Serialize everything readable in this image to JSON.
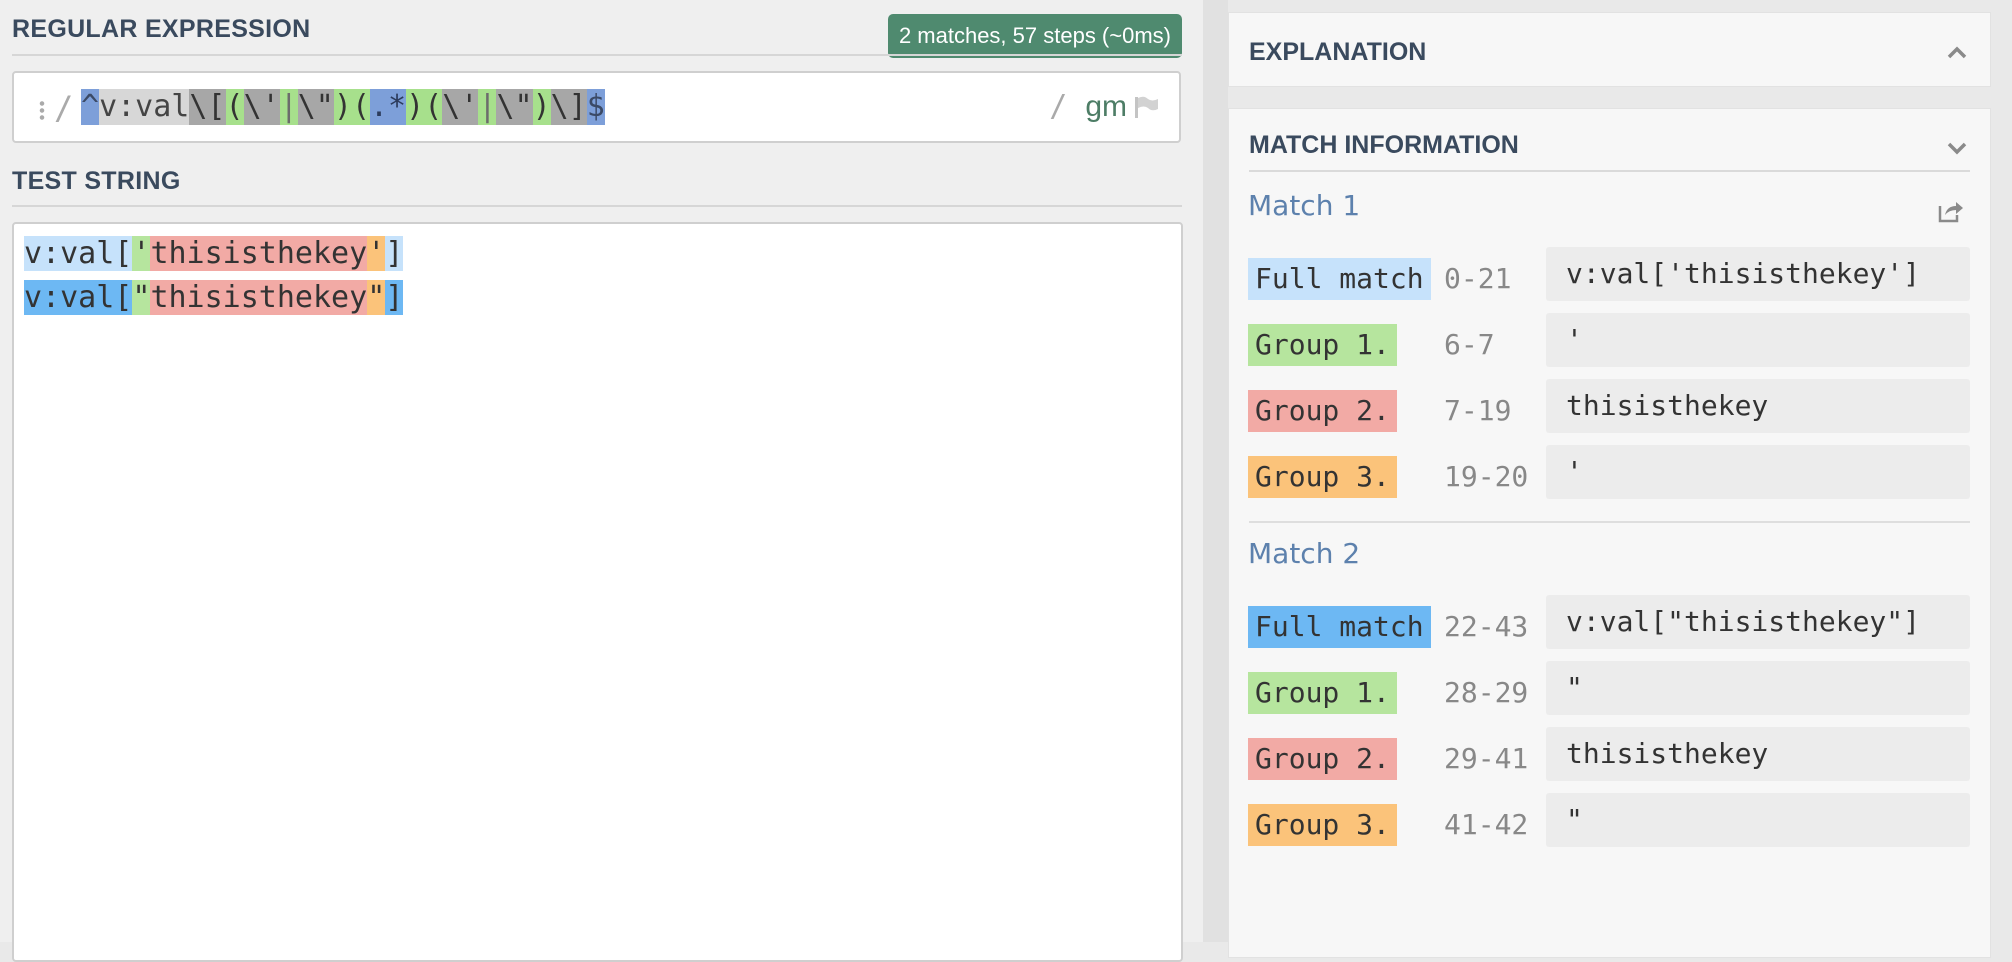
{
  "regex_section": {
    "title": "REGULAR EXPRESSION",
    "match_badge": "2 matches, 57 steps (~0ms)",
    "open_delimiter": "/",
    "tokens": [
      {
        "text": "^",
        "kind": "anchor"
      },
      {
        "text": "v:val",
        "kind": "lit"
      },
      {
        "text": "\\[",
        "kind": "esc"
      },
      {
        "text": "(",
        "kind": "grp"
      },
      {
        "text": "\\'",
        "kind": "esc"
      },
      {
        "text": "|",
        "kind": "alt"
      },
      {
        "text": "\\\"",
        "kind": "esc"
      },
      {
        "text": ")",
        "kind": "grp"
      },
      {
        "text": "(",
        "kind": "grp"
      },
      {
        "text": ".*",
        "kind": "dot"
      },
      {
        "text": ")",
        "kind": "grp"
      },
      {
        "text": "(",
        "kind": "grp"
      },
      {
        "text": "\\'",
        "kind": "esc"
      },
      {
        "text": "|",
        "kind": "alt"
      },
      {
        "text": "\\\"",
        "kind": "esc"
      },
      {
        "text": ")",
        "kind": "grp"
      },
      {
        "text": "\\]",
        "kind": "esc"
      },
      {
        "text": "$",
        "kind": "anchor"
      }
    ],
    "close_delimiter": "/",
    "flags": "gm",
    "flag_icon": "flag-icon"
  },
  "test_section": {
    "title": "TEST STRING",
    "lines": [
      [
        {
          "text": "v:val[",
          "hl": "full1"
        },
        {
          "text": "'",
          "hl": "g1"
        },
        {
          "text": "thisisthekey",
          "hl": "g2"
        },
        {
          "text": "'",
          "hl": "g3"
        },
        {
          "text": "]",
          "hl": "full1"
        }
      ],
      [
        {
          "text": "v:val[",
          "hl": "full2"
        },
        {
          "text": "\"",
          "hl": "g1"
        },
        {
          "text": "thisisthekey",
          "hl": "g2"
        },
        {
          "text": "\"",
          "hl": "g3"
        },
        {
          "text": "]",
          "hl": "full2"
        }
      ]
    ]
  },
  "explanation": {
    "title": "EXPLANATION",
    "icon": "chevron-up-icon"
  },
  "match_info": {
    "title": "MATCH INFORMATION",
    "icon": "chevron-down-icon",
    "share_icon": "share-icon",
    "matches": [
      {
        "header": "Match 1",
        "rows": [
          {
            "label": "Full match",
            "range": "0-21",
            "value": "v:val['thisisthekey']",
            "kind": "full1"
          },
          {
            "label": "Group 1.",
            "range": "6-7",
            "value": "'",
            "kind": "g1"
          },
          {
            "label": "Group 2.",
            "range": "7-19",
            "value": "thisisthekey",
            "kind": "g2"
          },
          {
            "label": "Group 3.",
            "range": "19-20",
            "value": "'",
            "kind": "g3"
          }
        ]
      },
      {
        "header": "Match 2",
        "rows": [
          {
            "label": "Full match",
            "range": "22-43",
            "value": "v:val[\"thisisthekey\"]",
            "kind": "full2"
          },
          {
            "label": "Group 1.",
            "range": "28-29",
            "value": "\"",
            "kind": "g1"
          },
          {
            "label": "Group 2.",
            "range": "29-41",
            "value": "thisisthekey",
            "kind": "g2"
          },
          {
            "label": "Group 3.",
            "range": "41-42",
            "value": "\"",
            "kind": "g3"
          }
        ]
      }
    ]
  },
  "colors": {
    "badge": "#4f8a6f",
    "full_match_1": "#c6e2fb",
    "full_match_2": "#6db8f3",
    "group_1": "#b6e59e",
    "group_2": "#f2aaa5",
    "group_3": "#fbc37a"
  }
}
